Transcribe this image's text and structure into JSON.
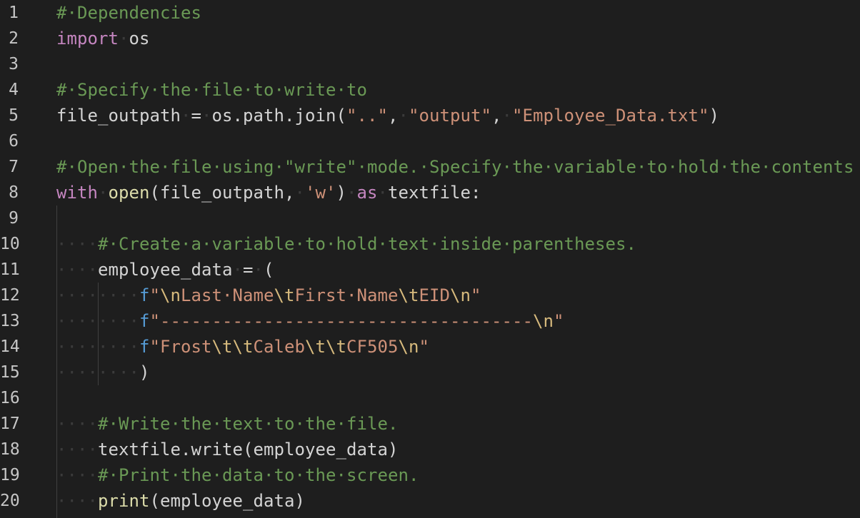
{
  "editor": {
    "colors": {
      "background": "#1e1e1e",
      "line_number": "#c6c6c6",
      "comment": "#6a9955",
      "keyword": "#c586c0",
      "string": "#ce9178",
      "escape": "#d7ba7d",
      "function": "#dcdcaa",
      "fstring_prefix": "#569cd6",
      "plain": "#d4d4d4",
      "whitespace_dot": "#3b3b3b",
      "indent_guide": "#404040"
    },
    "lines": [
      {
        "num": "1",
        "tokens": [
          {
            "t": "comment",
            "v": "#·Dependencies"
          }
        ]
      },
      {
        "num": "2",
        "tokens": [
          {
            "t": "keyword",
            "v": "import"
          },
          {
            "t": "ws",
            "v": "·"
          },
          {
            "t": "plain",
            "v": "os"
          }
        ]
      },
      {
        "num": "3",
        "tokens": []
      },
      {
        "num": "4",
        "tokens": [
          {
            "t": "comment",
            "v": "#·Specify·the·file·to·write·to"
          }
        ]
      },
      {
        "num": "5",
        "tokens": [
          {
            "t": "plain",
            "v": "file_outpath"
          },
          {
            "t": "ws",
            "v": "·"
          },
          {
            "t": "plain",
            "v": "="
          },
          {
            "t": "ws",
            "v": "·"
          },
          {
            "t": "plain",
            "v": "os.path.join("
          },
          {
            "t": "string",
            "v": "\"..\""
          },
          {
            "t": "plain",
            "v": ","
          },
          {
            "t": "ws",
            "v": "·"
          },
          {
            "t": "string",
            "v": "\"output\""
          },
          {
            "t": "plain",
            "v": ","
          },
          {
            "t": "ws",
            "v": "·"
          },
          {
            "t": "string",
            "v": "\"Employee_Data.txt\""
          },
          {
            "t": "plain",
            "v": ")"
          }
        ]
      },
      {
        "num": "6",
        "tokens": []
      },
      {
        "num": "7",
        "tokens": [
          {
            "t": "comment",
            "v": "#·Open·the·file·using·\"write\"·mode.·Specify·the·variable·to·hold·the·contents"
          }
        ]
      },
      {
        "num": "8",
        "tokens": [
          {
            "t": "keyword",
            "v": "with"
          },
          {
            "t": "ws",
            "v": "·"
          },
          {
            "t": "fn",
            "v": "open"
          },
          {
            "t": "plain",
            "v": "(file_outpath,"
          },
          {
            "t": "ws",
            "v": "·"
          },
          {
            "t": "string",
            "v": "'w'"
          },
          {
            "t": "plain",
            "v": ")"
          },
          {
            "t": "ws",
            "v": "·"
          },
          {
            "t": "keyword",
            "v": "as"
          },
          {
            "t": "ws",
            "v": "·"
          },
          {
            "t": "plain",
            "v": "textfile:"
          }
        ]
      },
      {
        "num": "9",
        "tokens": []
      },
      {
        "num": "10",
        "tokens": [
          {
            "t": "ws",
            "v": "····"
          },
          {
            "t": "comment",
            "v": "#·Create·a·variable·to·hold·text·inside·parentheses."
          }
        ]
      },
      {
        "num": "11",
        "tokens": [
          {
            "t": "ws",
            "v": "····"
          },
          {
            "t": "plain",
            "v": "employee_data"
          },
          {
            "t": "ws",
            "v": "·"
          },
          {
            "t": "plain",
            "v": "="
          },
          {
            "t": "ws",
            "v": "·"
          },
          {
            "t": "plain",
            "v": "("
          }
        ]
      },
      {
        "num": "12",
        "tokens": [
          {
            "t": "ws",
            "v": "········"
          },
          {
            "t": "fprefix",
            "v": "f"
          },
          {
            "t": "string",
            "v": "\""
          },
          {
            "t": "escape",
            "v": "\\n"
          },
          {
            "t": "string",
            "v": "Last·Name"
          },
          {
            "t": "escape",
            "v": "\\t"
          },
          {
            "t": "string",
            "v": "First·Name"
          },
          {
            "t": "escape",
            "v": "\\t"
          },
          {
            "t": "string",
            "v": "EID"
          },
          {
            "t": "escape",
            "v": "\\n"
          },
          {
            "t": "string",
            "v": "\""
          }
        ]
      },
      {
        "num": "13",
        "tokens": [
          {
            "t": "ws",
            "v": "········"
          },
          {
            "t": "fprefix",
            "v": "f"
          },
          {
            "t": "string",
            "v": "\"------------------------------------"
          },
          {
            "t": "escape",
            "v": "\\n"
          },
          {
            "t": "string",
            "v": "\""
          }
        ]
      },
      {
        "num": "14",
        "tokens": [
          {
            "t": "ws",
            "v": "········"
          },
          {
            "t": "fprefix",
            "v": "f"
          },
          {
            "t": "string",
            "v": "\"Frost"
          },
          {
            "t": "escape",
            "v": "\\t\\t"
          },
          {
            "t": "string",
            "v": "Caleb"
          },
          {
            "t": "escape",
            "v": "\\t\\t"
          },
          {
            "t": "string",
            "v": "CF505"
          },
          {
            "t": "escape",
            "v": "\\n"
          },
          {
            "t": "string",
            "v": "\""
          }
        ]
      },
      {
        "num": "15",
        "tokens": [
          {
            "t": "ws",
            "v": "········"
          },
          {
            "t": "plain",
            "v": ")"
          }
        ]
      },
      {
        "num": "16",
        "tokens": []
      },
      {
        "num": "17",
        "tokens": [
          {
            "t": "ws",
            "v": "····"
          },
          {
            "t": "comment",
            "v": "#·Write·the·text·to·the·file."
          }
        ]
      },
      {
        "num": "18",
        "tokens": [
          {
            "t": "ws",
            "v": "····"
          },
          {
            "t": "plain",
            "v": "textfile.write(employee_data)"
          }
        ]
      },
      {
        "num": "19",
        "tokens": [
          {
            "t": "ws",
            "v": "····"
          },
          {
            "t": "comment",
            "v": "#·Print·the·data·to·the·screen."
          }
        ]
      },
      {
        "num": "20",
        "tokens": [
          {
            "t": "ws",
            "v": "····"
          },
          {
            "t": "fn",
            "v": "print"
          },
          {
            "t": "plain",
            "v": "(employee_data)"
          }
        ]
      }
    ]
  }
}
